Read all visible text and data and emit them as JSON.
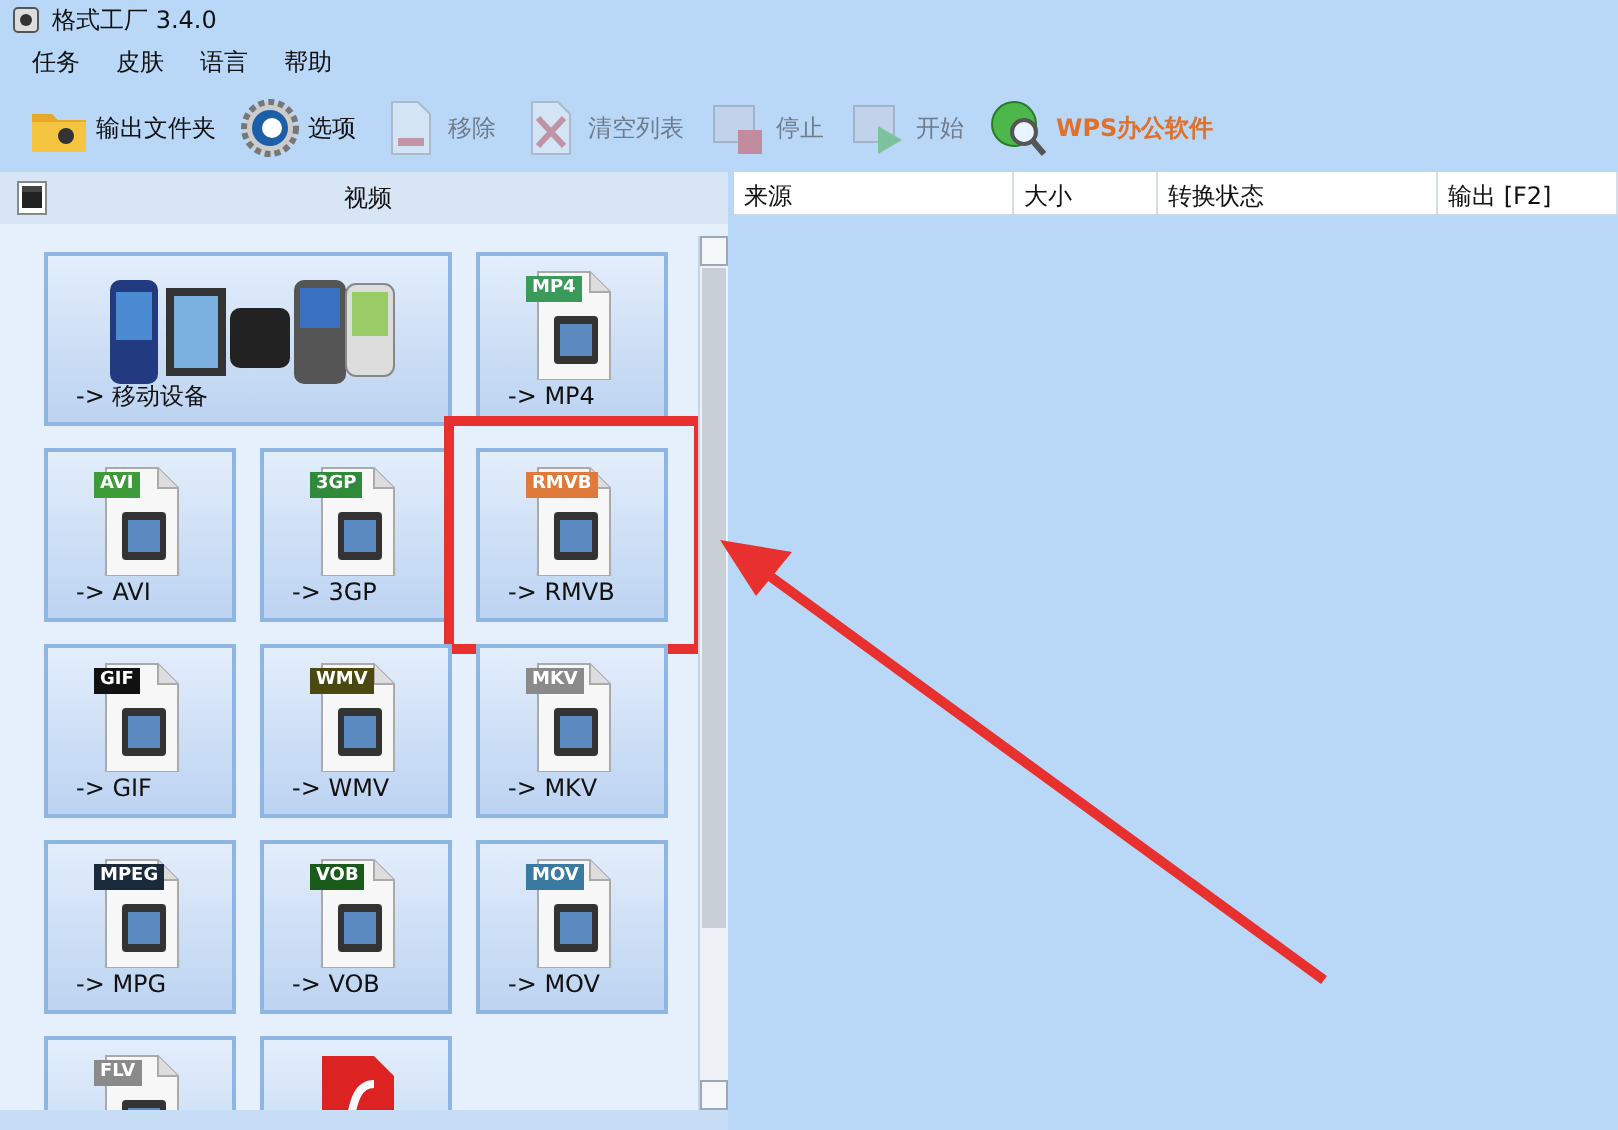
{
  "window": {
    "title": "格式工厂 3.4.0"
  },
  "menu": [
    "任务",
    "皮肤",
    "语言",
    "帮助"
  ],
  "toolbar": [
    {
      "label": "输出文件夹",
      "kind": "folder",
      "disabled": false
    },
    {
      "label": "选项",
      "kind": "gear",
      "disabled": false
    },
    {
      "label": "移除",
      "kind": "remove",
      "disabled": true
    },
    {
      "label": "清空列表",
      "kind": "clear",
      "disabled": true
    },
    {
      "label": "停止",
      "kind": "stop",
      "disabled": true
    },
    {
      "label": "开始",
      "kind": "start",
      "disabled": true
    },
    {
      "label": "WPS办公软件",
      "kind": "link",
      "disabled": false
    }
  ],
  "category": {
    "title": "视频"
  },
  "tiles": [
    {
      "kind": "wide",
      "label": "-> 移动设备",
      "highlighted": false
    },
    {
      "kind": "file",
      "badge": "MP4",
      "color": "#3a9a5a",
      "label": "-> MP4",
      "highlighted": false
    },
    {
      "kind": "file",
      "badge": "AVI",
      "color": "#3f9a3a",
      "label": "-> AVI",
      "highlighted": false
    },
    {
      "kind": "file",
      "badge": "3GP",
      "color": "#2f8a3a",
      "label": "-> 3GP",
      "highlighted": false
    },
    {
      "kind": "file",
      "badge": "RMVB",
      "color": "#e07a3a",
      "label": "-> RMVB",
      "highlighted": true
    },
    {
      "kind": "file",
      "badge": "GIF",
      "color": "#111111",
      "label": "-> GIF",
      "highlighted": false
    },
    {
      "kind": "file",
      "badge": "WMV",
      "color": "#4a4a10",
      "label": "-> WMV",
      "highlighted": false
    },
    {
      "kind": "file",
      "badge": "MKV",
      "color": "#8a8a8a",
      "label": "-> MKV",
      "highlighted": false
    },
    {
      "kind": "file",
      "badge": "MPEG",
      "color": "#1a2a3a",
      "label": "-> MPG",
      "highlighted": false
    },
    {
      "kind": "file",
      "badge": "VOB",
      "color": "#1a5a1a",
      "label": "-> VOB",
      "highlighted": false
    },
    {
      "kind": "file",
      "badge": "MOV",
      "color": "#3a7aa0",
      "label": "-> MOV",
      "highlighted": false
    },
    {
      "kind": "file",
      "badge": "FLV",
      "color": "#8a8a8a",
      "highlighted": false
    },
    {
      "kind": "flash",
      "highlighted": false
    }
  ],
  "table": {
    "columns": [
      "来源",
      "大小",
      "转换状态",
      "输出 [F2]"
    ]
  }
}
